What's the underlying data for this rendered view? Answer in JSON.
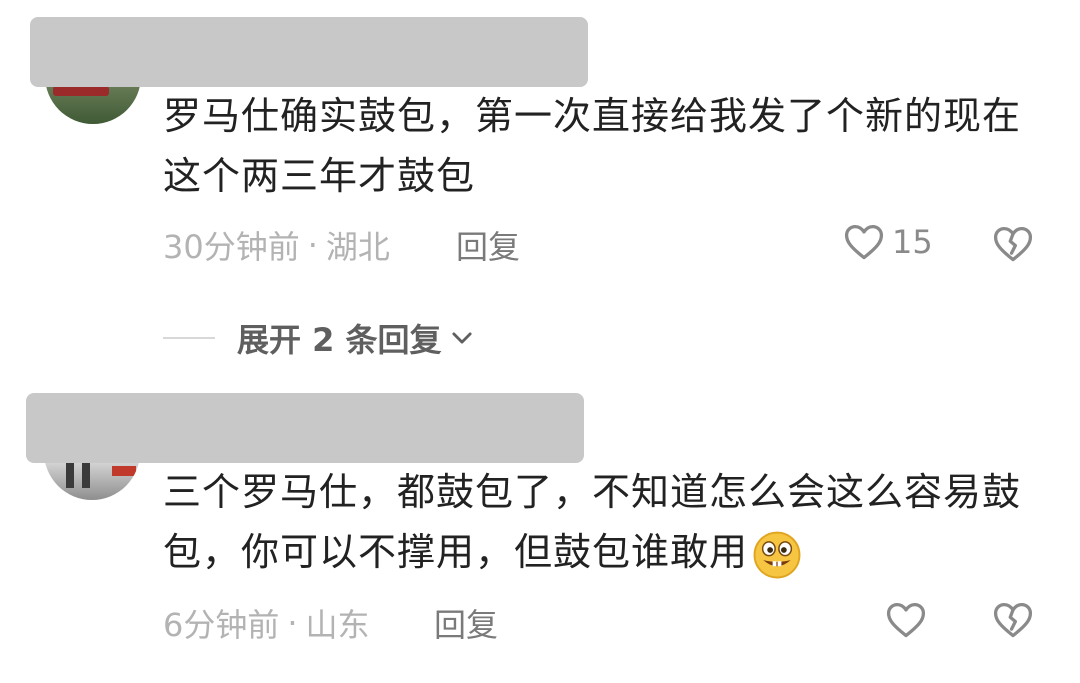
{
  "comments": [
    {
      "text": "罗马仕确实鼓包，第一次直接给我发了个新的现在这个两三年才鼓包",
      "time": "30分钟前",
      "location": "湖北",
      "reply_label": "回复",
      "likes": "15",
      "like_icon": "heart-outline-icon",
      "dislike_icon": "broken-heart-icon",
      "expand_replies_label": "展开 2 条回复"
    },
    {
      "text": "三个罗马仕，都鼓包了，不知道怎么会这么容易鼓包，你可以不撑用，但鼓包谁敢用",
      "emoji": "grinning-face-emoji",
      "time": "6分钟前",
      "location": "山东",
      "reply_label": "回复",
      "like_icon": "heart-outline-icon",
      "dislike_icon": "broken-heart-icon"
    }
  ],
  "separator": "·"
}
